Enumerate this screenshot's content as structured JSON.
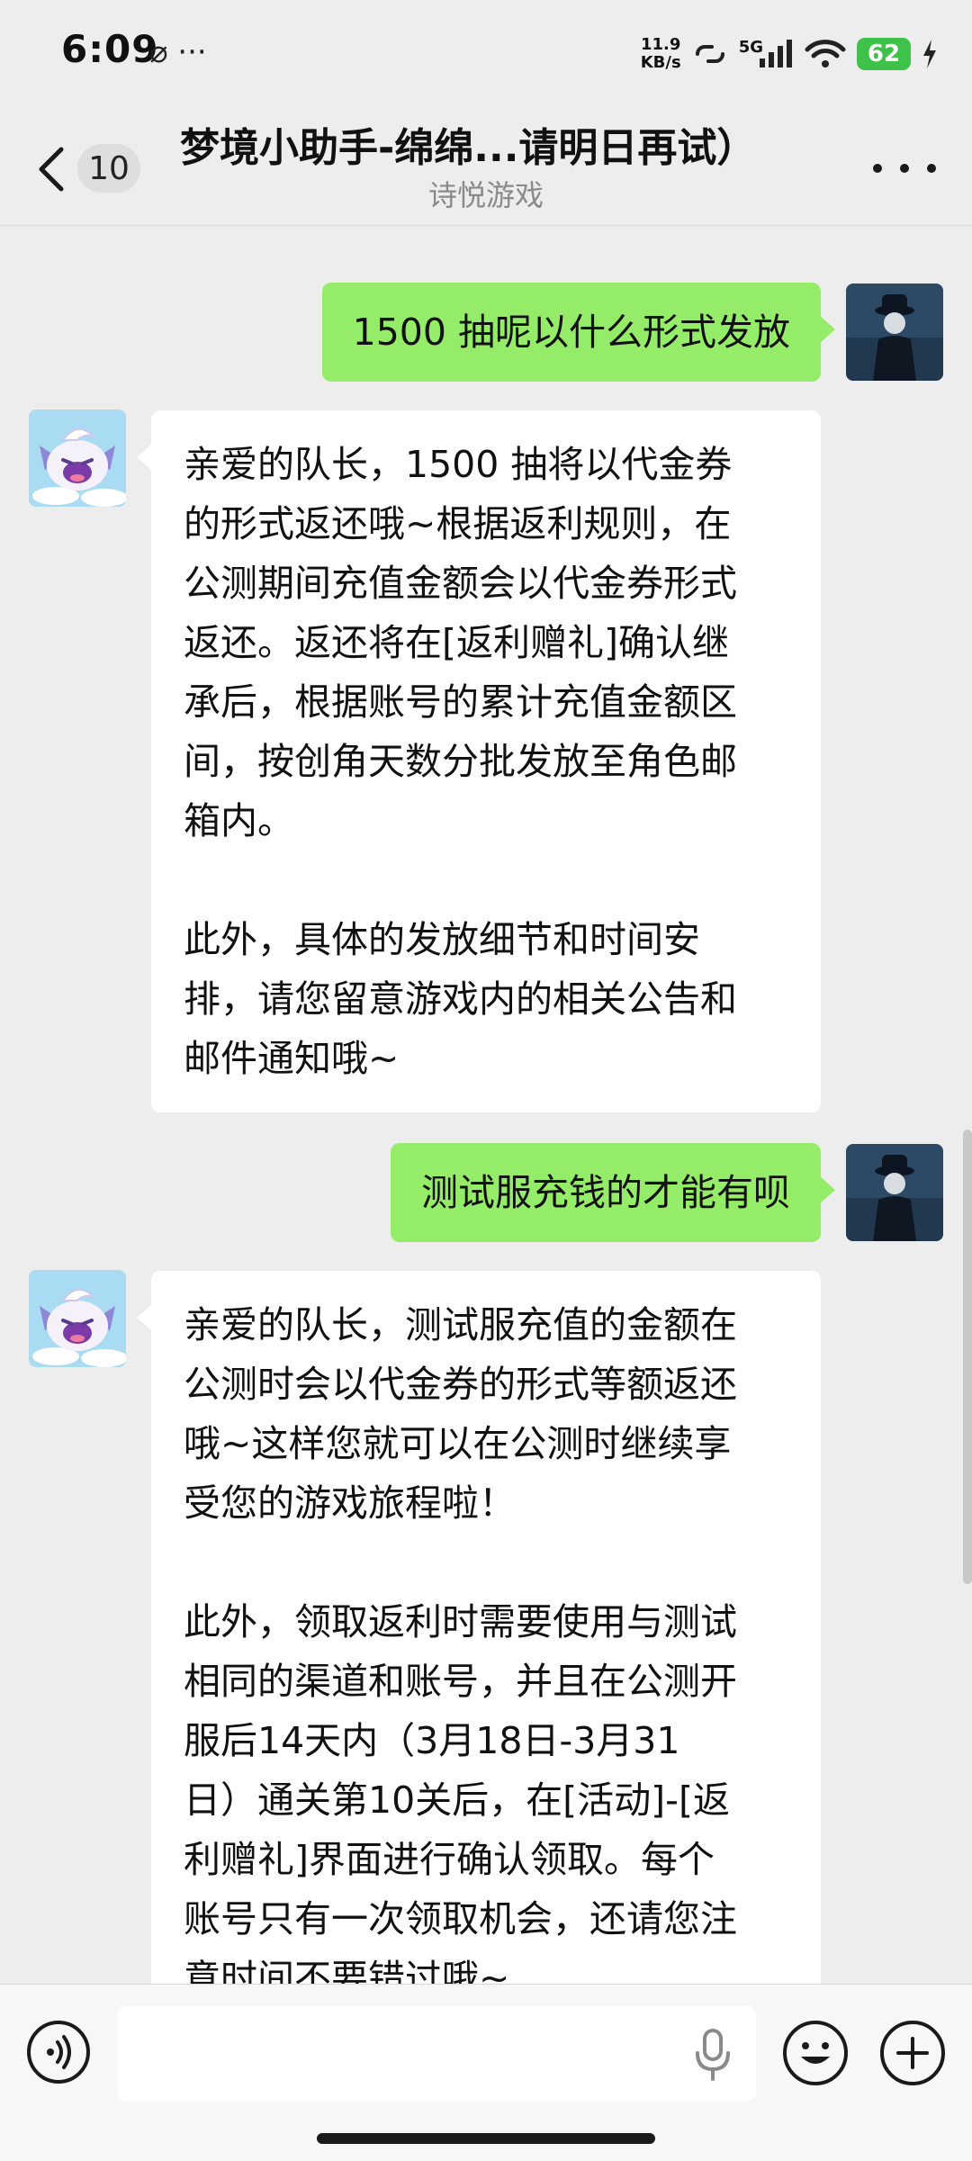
{
  "status_bar": {
    "time": "6:09",
    "left_icons": "⌀ ···",
    "net_speed_value": "11.9",
    "net_speed_unit": "KB/s",
    "network": "5G",
    "battery": "62"
  },
  "header": {
    "back_badge": "10",
    "title": "梦境小助手-绵绵...请明日再试）",
    "subtitle": "诗悦游戏"
  },
  "messages": [
    {
      "sender": "me",
      "text": "1500 抽呢以什么形式发放"
    },
    {
      "sender": "bot",
      "text": "亲爱的队长，1500 抽将以代金券\n的形式返还哦~根据返利规则，在\n公测期间充值金额会以代金券形式\n返还。返还将在[返利赠礼]确认继\n承后，根据账号的累计充值金额区\n间，按创角天数分批发放至角色邮\n箱内。\n\n此外，具体的发放细节和时间安\n排，请您留意游戏内的相关公告和\n邮件通知哦~"
    },
    {
      "sender": "me",
      "text": "测试服充钱的才能有呗"
    },
    {
      "sender": "bot",
      "text": "亲爱的队长，测试服充值的金额在\n公测时会以代金券的形式等额返还\n哦~这样您就可以在公测时继续享\n受您的游戏旅程啦！\n\n此外，领取返利时需要使用与测试\n相同的渠道和账号，并且在公测开\n服后14天内（3月18日-3月31\n日）通关第10关后，在[活动]-[返\n利赠礼]界面进行确认领取。每个\n账号只有一次领取机会，还请您注\n意时间不要错过哦~"
    }
  ],
  "input": {
    "value": "",
    "placeholder": ""
  },
  "colors": {
    "self_bubble": "#95ec69",
    "bot_bubble": "#ffffff",
    "background": "#ededed"
  }
}
